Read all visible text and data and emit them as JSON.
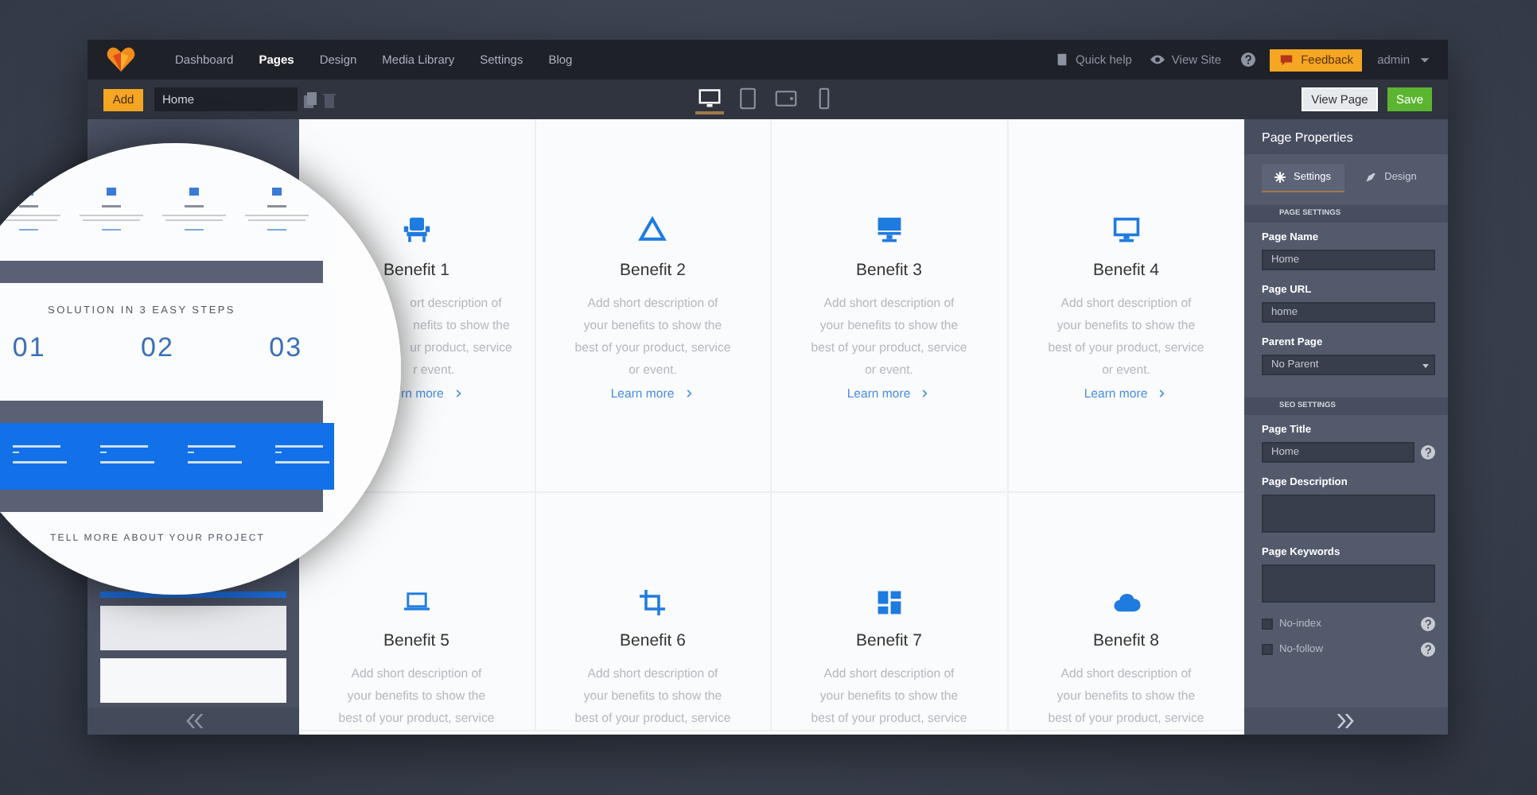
{
  "nav": {
    "items": [
      {
        "label": "Dashboard",
        "selected": false
      },
      {
        "label": "Pages",
        "selected": true
      },
      {
        "label": "Design",
        "selected": false
      },
      {
        "label": "Media Library",
        "selected": false
      },
      {
        "label": "Settings",
        "selected": false
      },
      {
        "label": "Blog",
        "selected": false
      }
    ],
    "quick_help": "Quick help",
    "view_site": "View Site",
    "feedback": "Feedback",
    "user": "admin"
  },
  "toolbar": {
    "add": "Add",
    "page_field": "Home",
    "devices": [
      {
        "kind": "desktop",
        "selected": true
      },
      {
        "kind": "tablet",
        "selected": false
      },
      {
        "kind": "landscape",
        "selected": false
      },
      {
        "kind": "phone",
        "selected": false
      }
    ],
    "view_page": "View Page",
    "save": "Save"
  },
  "benefits": [
    {
      "kind": "seat",
      "title": "Benefit 1",
      "description": [
        "ort description of",
        "nefits to show the",
        "ur product, service",
        "r event."
      ],
      "link": "rn more",
      "partial": true
    },
    {
      "kind": "triangle",
      "title": "Benefit 2",
      "description": [
        "Add short description of",
        "your benefits to show the",
        "best of your product, service",
        "or event."
      ],
      "link": "Learn more",
      "partial": false
    },
    {
      "kind": "register",
      "title": "Benefit 3",
      "description": [
        "Add short description of",
        "your benefits to show the",
        "best of your product, service",
        "or event."
      ],
      "link": "Learn more",
      "partial": false
    },
    {
      "kind": "monitor",
      "title": "Benefit 4",
      "description": [
        "Add short description of",
        "your benefits to show the",
        "best of your product, service",
        "or event."
      ],
      "link": "Learn more",
      "partial": false
    },
    {
      "kind": "laptop",
      "title": "Benefit 5",
      "description": [
        "Add short description of",
        "your benefits to show the",
        "best of your product, service"
      ],
      "partial": false
    },
    {
      "kind": "crop",
      "title": "Benefit 6",
      "description": [
        "Add short description of",
        "your benefits to show the",
        "best of your product, service"
      ],
      "partial": false
    },
    {
      "kind": "tiles",
      "title": "Benefit 7",
      "description": [
        "Add short description of",
        "your benefits to show the",
        "best of your product, service"
      ],
      "partial": false
    },
    {
      "kind": "cloud",
      "title": "Benefit 8",
      "description": [
        "Add short description of",
        "your benefits to show the",
        "best of your product, service"
      ],
      "partial": false
    }
  ],
  "magnifier": {
    "steps_title": "SOLUTION IN 3 EASY STEPS",
    "steps": [
      "01",
      "02",
      "03"
    ],
    "contact_title": "TELL MORE ABOUT YOUR PROJECT"
  },
  "properties": {
    "title": "Page Properties",
    "tabs": [
      {
        "label": "Settings",
        "selected": true
      },
      {
        "label": "Design",
        "selected": false
      }
    ],
    "sections": [
      {
        "title": "PAGE SETTINGS",
        "fields": [
          {
            "kind": "text",
            "label": "Page Name",
            "value": "Home"
          },
          {
            "kind": "text",
            "label": "Page URL",
            "value": "home"
          },
          {
            "kind": "select",
            "label": "Parent Page",
            "value": "No Parent"
          }
        ]
      },
      {
        "title": "SEO SETTINGS",
        "fields": [
          {
            "kind": "help-text",
            "label": "Page Title",
            "value": "Home"
          },
          {
            "kind": "textarea",
            "label": "Page Description"
          },
          {
            "kind": "textarea",
            "label": "Page Keywords"
          },
          {
            "kind": "checkbox",
            "label": "No-index",
            "checked": false
          },
          {
            "kind": "checkbox",
            "label": "No-follow",
            "checked": false
          }
        ]
      }
    ]
  }
}
